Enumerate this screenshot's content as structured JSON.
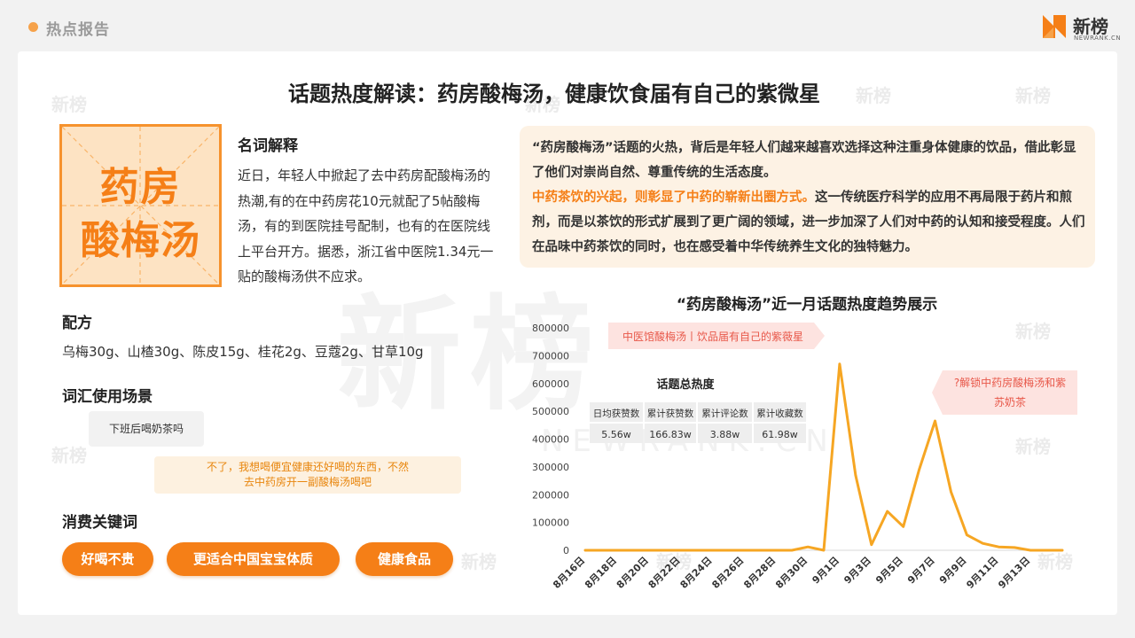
{
  "header": {
    "report_label": "热点报告",
    "logo_name": "新榜",
    "logo_sub": "NEWRANK.CN"
  },
  "watermark": {
    "big": "新榜",
    "big_sub": "NEWRANK.CN",
    "small": "新榜"
  },
  "title": "话题热度解读：药房酸梅汤，健康饮食届有自己的紫微星",
  "sticker": {
    "line1": "药房",
    "line2": "酸梅汤"
  },
  "definition": {
    "heading": "名词解释",
    "body": "近日，年轻人中掀起了去中药房配酸梅汤的热潮,有的在中药房花10元就配了5帖酸梅汤，有的到医院挂号配制，也有的在医院线上平台开方。据悉，浙江省中医院1.34元一贴的酸梅汤供不应求。"
  },
  "recipe": {
    "heading": "配方",
    "text": "乌梅30g、山楂30g、陈皮15g、桂花2g、豆蔻2g、甘草10g"
  },
  "scene": {
    "heading": "词汇使用场景",
    "bubble1": "下班后喝奶茶吗",
    "bubble2_line1": "不了，我想喝便宜健康还好喝的东西，不然",
    "bubble2_line2": "去中药房开一副酸梅汤喝吧"
  },
  "keywords": {
    "heading": "消费关键词",
    "items": [
      "好喝不贵",
      "更适合中国宝宝体质",
      "健康食品"
    ]
  },
  "summary": {
    "p1": "“药房酸梅汤”话题的火热，背后是年轻人们越来越喜欢选择这种注重身体健康的饮品，借此彰显了他们对崇尚自然、尊重传统的生活态度。",
    "p2_highlight": "中药茶饮的兴起，则彰显了中药的崭新出圈方式。",
    "p2_rest": "这一传统医疗科学的应用不再局限于药片和煎剂，而是以茶饮的形式扩展到了更广阔的领域，进一步加深了人们对中药的认知和接受程度。人们在品味中药茶饮的同时，也在感受着中华传统养生文化的独特魅力。"
  },
  "chart_data": {
    "type": "line",
    "title": "“药房酸梅汤”近一月话题热度趋势展示",
    "x": [
      "8月16日",
      "8月17日",
      "8月18日",
      "8月19日",
      "8月20日",
      "8月21日",
      "8月22日",
      "8月23日",
      "8月24日",
      "8月25日",
      "8月26日",
      "8月27日",
      "8月28日",
      "8月29日",
      "8月30日",
      "8月31日",
      "9月1日",
      "9月2日",
      "9月3日",
      "9月4日",
      "9月5日",
      "9月6日",
      "9月7日",
      "9月8日",
      "9月9日",
      "9月10日",
      "9月11日",
      "9月12日",
      "9月13日",
      "9月14日",
      "9月15日"
    ],
    "x_tick_labels": [
      "8月16日",
      "8月18日",
      "8月20日",
      "8月22日",
      "8月24日",
      "8月26日",
      "8月28日",
      "8月30日",
      "9月1日",
      "9月3日",
      "9月5日",
      "9月7日",
      "9月9日",
      "9月11日",
      "9月13日"
    ],
    "values": [
      0,
      0,
      0,
      0,
      0,
      0,
      0,
      0,
      0,
      0,
      0,
      0,
      0,
      0,
      12000,
      0,
      670000,
      270000,
      20000,
      140000,
      85000,
      290000,
      465000,
      210000,
      55000,
      25000,
      12000,
      10000,
      0,
      0,
      0
    ],
    "y_ticks": [
      0,
      100000,
      200000,
      300000,
      400000,
      500000,
      600000,
      700000,
      800000
    ],
    "ylim": [
      0,
      800000
    ],
    "line_color": "#f6a623",
    "annotations": [
      "中医馆酸梅汤丨饮品届有自己的紫薇星",
      "?解锁中药房酸梅汤和紫苏奶茶"
    ],
    "stats_table": {
      "title": "话题总热度",
      "headers": [
        "日均获赞数",
        "累计获赞数",
        "累计评论数",
        "累计收藏数"
      ],
      "values": [
        "5.56w",
        "166.83w",
        "3.88w",
        "61.98w"
      ]
    }
  }
}
